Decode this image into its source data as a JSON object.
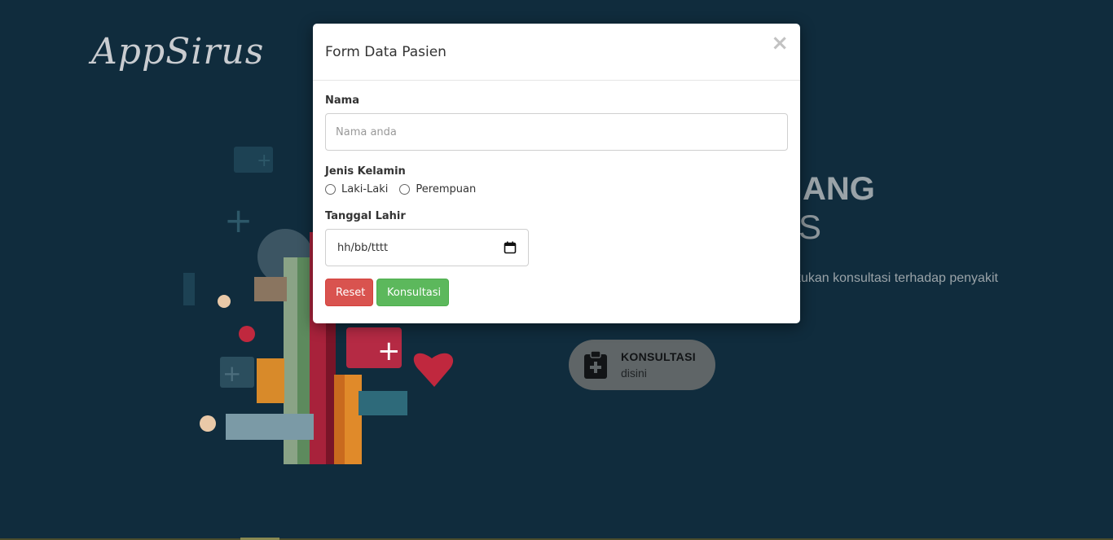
{
  "background": {
    "logo": "AppSirus",
    "hero_title": "ANG",
    "hero_subtitle": "S",
    "hero_description": "kukan konsultasi terhadap penyakit",
    "cta": {
      "title": "KONSULTASI",
      "subtitle": "disini",
      "icon": "clipboard-medical-icon"
    }
  },
  "modal": {
    "title": "Form Data Pasien",
    "close_label": "×",
    "name": {
      "label": "Nama",
      "placeholder": "Nama anda",
      "value": ""
    },
    "gender": {
      "label": "Jenis Kelamin",
      "options": [
        "Laki-Laki",
        "Perempuan"
      ],
      "selected": null
    },
    "birthdate": {
      "label": "Tanggal Lahir",
      "placeholder": "hh/bb/tttt",
      "icon": "calendar-icon"
    },
    "buttons": {
      "reset": "Reset",
      "submit": "Konsultasi"
    }
  },
  "colors": {
    "page_background": "#102c3d",
    "reset_button": "#d9534f",
    "submit_button": "#5cb85c"
  }
}
